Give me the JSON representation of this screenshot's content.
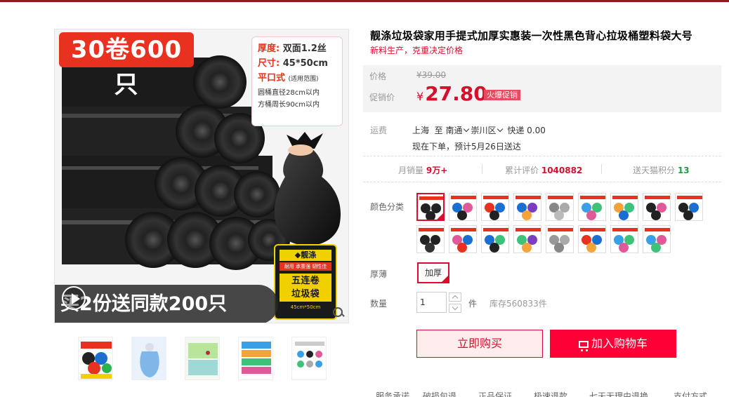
{
  "gallery": {
    "badge": "30卷600只",
    "spec": {
      "thickness_key": "厚度:",
      "thickness_val": "双面1.2丝",
      "size_key": "尺寸:",
      "size_val": "45*50cm",
      "style": "平口式",
      "scope": "(适用范围)",
      "round": "圆桶直径28cm以内",
      "square": "方桶周长90cm以内"
    },
    "banner": "买2份送同款200只",
    "pack": {
      "brand": "◆靓涤",
      "slogan": "耐用 承重强 韧性佳",
      "title_1": "五连卷",
      "title_2": "垃圾袋",
      "size": "45cm*50cm"
    },
    "thumbs": [
      "thumb-1",
      "thumb-2",
      "thumb-3",
      "thumb-4",
      "thumb-5"
    ]
  },
  "product": {
    "title": "靓涤垃圾袋家用手提式加厚实惠装一次性黑色背心拉圾桶塑料袋大号",
    "subtitle": "新料生产，克重决定价格"
  },
  "price": {
    "label": "价格",
    "original": "¥39.00",
    "promo_label": "促销价",
    "currency": "¥",
    "promo": "27.80",
    "hot_tag": "火爆促销"
  },
  "shipping": {
    "label": "运费",
    "from": "上海",
    "to": "至",
    "city": "南通",
    "district": "崇川区",
    "method": "快递 0.00",
    "date": "现在下单，预计5月26日送达"
  },
  "stats": {
    "monthly_label": "月销量",
    "monthly_value": "9万+",
    "reviews_label": "累计评价",
    "reviews_value": "1040882",
    "points_label": "送天猫积分",
    "points_value": "13"
  },
  "options": {
    "color_label": "颜色分类",
    "thick_label": "厚薄",
    "thick_value": "加厚",
    "qty_label": "数量",
    "qty_value": "1",
    "qty_unit": "件",
    "stock": "库存560833件"
  },
  "actions": {
    "buy": "立即购买",
    "cart": "加入购物车"
  },
  "services": [
    "服务承诺",
    "破损包退",
    "正品保证",
    "极速退款",
    "七天无理由退换",
    "支付方式"
  ],
  "colors": {
    "accent": "#d70e2c",
    "cart": "#ff0036",
    "price_bg": "#f3f3f3"
  }
}
